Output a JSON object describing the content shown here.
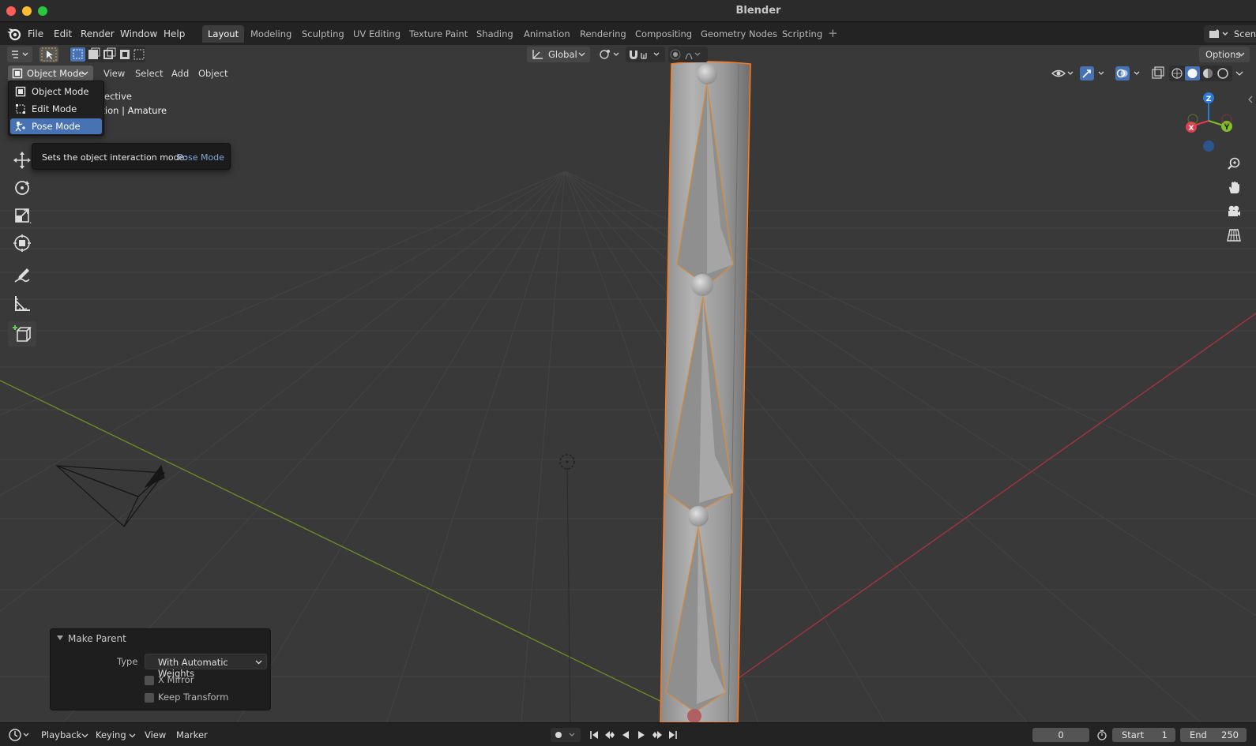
{
  "window": {
    "title": "Blender"
  },
  "menu": {
    "file": "File",
    "edit": "Edit",
    "render": "Render",
    "window": "Window",
    "help": "Help"
  },
  "workspaces": [
    "Layout",
    "Modeling",
    "Sculpting",
    "UV Editing",
    "Texture Paint",
    "Shading",
    "Animation",
    "Rendering",
    "Compositing",
    "Geometry Nodes",
    "Scripting"
  ],
  "active_workspace": "Layout",
  "scene_label": "Scene",
  "header": {
    "mode": "Object Mode",
    "view": "View",
    "select": "Select",
    "add": "Add",
    "object": "Object",
    "orientation": "Global",
    "options": "Options"
  },
  "viewport_overlay": {
    "view_name_partial": "ective",
    "collection_partial": "ection | Amature"
  },
  "mode_menu": {
    "items": [
      "Object Mode",
      "Edit Mode",
      "Pose Mode"
    ],
    "selected": "Pose Mode"
  },
  "tooltip": {
    "text": "Sets the object interaction mode:",
    "value": "Pose Mode"
  },
  "make_parent": {
    "title": "Make Parent",
    "type_label": "Type",
    "type_value": "With Automatic Weights",
    "x_mirror": "X Mirror",
    "keep_transform": "Keep Transform"
  },
  "timeline": {
    "playback": "Playback",
    "keying": "Keying",
    "view": "View",
    "marker": "Marker",
    "current_frame": "0",
    "start_label": "Start",
    "start_value": "1",
    "end_label": "End",
    "end_value": "250"
  },
  "gizmo": {
    "x": "X",
    "y": "Y",
    "z": "Z"
  },
  "colors": {
    "accent": "#4772b3",
    "selection_outline": "#ff7a1a",
    "axis_x": "#e63b4e",
    "axis_y": "#7fbf28",
    "axis_z": "#2a7bd6"
  }
}
